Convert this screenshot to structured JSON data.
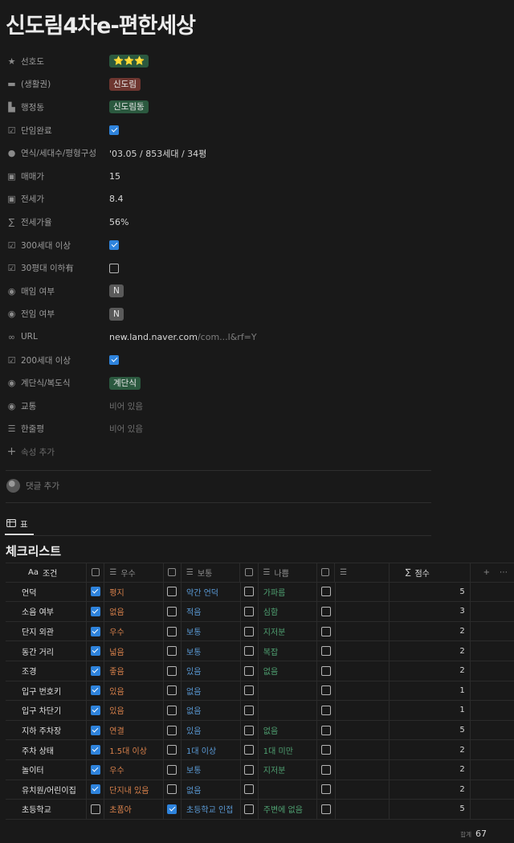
{
  "page": {
    "title": "신도림4차e-편한세상"
  },
  "properties": [
    {
      "name": "prop-preference",
      "icon": "star-icon",
      "label": "선호도",
      "type": "tag",
      "value": "⭐⭐⭐",
      "tag_color": "green"
    },
    {
      "name": "prop-area",
      "icon": "folder-icon",
      "label": "(생활권)",
      "type": "tag",
      "value": "신도림",
      "tag_color": "red"
    },
    {
      "name": "prop-district",
      "icon": "city-icon",
      "label": "행정동",
      "type": "tag",
      "value": "신도림동",
      "tag_color": "green"
    },
    {
      "name": "prop-single-complete",
      "icon": "checkbox-icon",
      "label": "단임완료",
      "type": "checkbox",
      "checked": true
    },
    {
      "name": "prop-year-units",
      "icon": "pin-icon",
      "label": "연식/세대수/평형구성",
      "type": "text",
      "value": "'03.05 / 853세대 / 34평"
    },
    {
      "name": "prop-sale-price",
      "icon": "money-icon",
      "label": "매매가",
      "type": "text",
      "value": "15"
    },
    {
      "name": "prop-jeonse-price",
      "icon": "money-icon",
      "label": "전세가",
      "type": "text",
      "value": "8.4"
    },
    {
      "name": "prop-jeonse-rate",
      "icon": "sigma-icon",
      "label": "전세가율",
      "type": "text",
      "value": "56%"
    },
    {
      "name": "prop-300-units",
      "icon": "checkbox-icon",
      "label": "300세대 이상",
      "type": "checkbox",
      "checked": true
    },
    {
      "name": "prop-under-30",
      "icon": "checkbox-icon",
      "label": "30평대 이하有",
      "type": "checkbox",
      "checked": false
    },
    {
      "name": "prop-sale-availability",
      "icon": "select-icon",
      "label": "매임 여부",
      "type": "tag",
      "value": "N",
      "tag_color": "gray"
    },
    {
      "name": "prop-lease-availability",
      "icon": "select-icon",
      "label": "전임 여부",
      "type": "tag",
      "value": "N",
      "tag_color": "gray"
    },
    {
      "name": "prop-url",
      "icon": "link-icon",
      "label": "URL",
      "type": "url",
      "value": "new.land.naver.com",
      "value_dim": "/com...l&rf=Y"
    },
    {
      "name": "prop-200-units",
      "icon": "checkbox-icon",
      "label": "200세대 이상",
      "type": "checkbox",
      "checked": true
    },
    {
      "name": "prop-stair-type",
      "icon": "select-icon",
      "label": "계단식/복도식",
      "type": "tag",
      "value": "계단식",
      "tag_color": "green"
    },
    {
      "name": "prop-transport",
      "icon": "select-icon",
      "label": "교통",
      "type": "empty",
      "value": "비어 있음"
    },
    {
      "name": "prop-one-line-review",
      "icon": "lines-icon",
      "label": "한줄평",
      "type": "empty",
      "value": "비어 있음"
    }
  ],
  "add_property_label": "속성 추가",
  "comment": {
    "placeholder": "댓글 추가"
  },
  "view": {
    "tab_label": "표"
  },
  "database": {
    "title": "체크리스트",
    "headers": {
      "name": "조건",
      "name_prefix": "Aa",
      "good": "우수",
      "normal": "보통",
      "bad": "나쁨",
      "score": "점수"
    },
    "rows": [
      {
        "name": "언덕",
        "c1": true,
        "t1": "평지",
        "c2": false,
        "t2": "약간 언덕",
        "c3": false,
        "t3": "가파름",
        "c4": false,
        "score": "5"
      },
      {
        "name": "소음 여부",
        "c1": true,
        "t1": "없음",
        "c2": false,
        "t2": "적음",
        "c3": false,
        "t3": "심함",
        "c4": false,
        "score": "3"
      },
      {
        "name": "단지 외관",
        "c1": true,
        "t1": "우수",
        "c2": false,
        "t2": "보통",
        "c3": false,
        "t3": "지저분",
        "c4": false,
        "score": "2"
      },
      {
        "name": "동간 거리",
        "c1": true,
        "t1": "넓음",
        "c2": false,
        "t2": "보통",
        "c3": false,
        "t3": "복잡",
        "c4": false,
        "score": "2"
      },
      {
        "name": "조경",
        "c1": true,
        "t1": "좋음",
        "c2": false,
        "t2": "있음",
        "c3": false,
        "t3": "없음",
        "c4": false,
        "score": "2"
      },
      {
        "name": "입구 번호키",
        "c1": true,
        "t1": "있음",
        "c2": false,
        "t2": "없음",
        "c3": false,
        "t3": "",
        "c4": false,
        "score": "1"
      },
      {
        "name": "입구 차단기",
        "c1": true,
        "t1": "있음",
        "c2": false,
        "t2": "없음",
        "c3": false,
        "t3": "",
        "c4": false,
        "score": "1"
      },
      {
        "name": "지하 주차장",
        "c1": true,
        "t1": "연결",
        "c2": false,
        "t2": "있음",
        "c3": false,
        "t3": "없음",
        "c4": false,
        "score": "5"
      },
      {
        "name": "주차 상태",
        "c1": true,
        "t1": "1.5대 이상",
        "c2": false,
        "t2": "1대 이상",
        "c3": false,
        "t3": "1대 미만",
        "c4": false,
        "score": "2"
      },
      {
        "name": "놀이터",
        "c1": true,
        "t1": "우수",
        "c2": false,
        "t2": "보통",
        "c3": false,
        "t3": "지저분",
        "c4": false,
        "score": "2"
      },
      {
        "name": "유치원/어린이집",
        "c1": true,
        "t1": "단지내 있음",
        "c2": false,
        "t2": "없음",
        "c3": false,
        "t3": "",
        "c4": false,
        "score": "2"
      },
      {
        "name": "초등학교",
        "c1": false,
        "t1": "초품아",
        "c2": true,
        "t2": "초등학교 인접",
        "c3": false,
        "t3": "주변에 없음",
        "c4": false,
        "score": "5"
      }
    ],
    "total_label": "합계",
    "total_value": "67"
  },
  "colors": {
    "tag_green": "#2b593f",
    "tag_red": "#6e3630",
    "tag_gray": "#5a5a5a",
    "checkbox_blue": "#2e83dc",
    "good_text": "#d9814b",
    "normal_text": "#5a9ad6",
    "bad_text": "#4fa272"
  }
}
